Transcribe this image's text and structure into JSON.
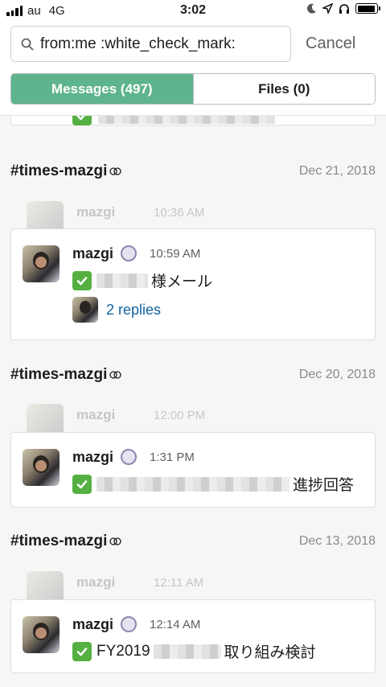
{
  "status_bar": {
    "carrier": "au",
    "network": "4G",
    "time": "3:02"
  },
  "search": {
    "query": "from:me :white_check_mark:",
    "cancel_label": "Cancel"
  },
  "tabs": [
    {
      "label": "Messages (497)",
      "active": true
    },
    {
      "label": "Files (0)",
      "active": false
    }
  ],
  "groups": [
    {
      "channel": "#times-mazgi",
      "date": "Dec 21, 2018",
      "ghost": {
        "name": "mazgi",
        "time": "10:36 AM"
      },
      "message": {
        "author": "mazgi",
        "time": "10:59 AM",
        "text": "様メール",
        "replies": "2 replies"
      }
    },
    {
      "channel": "#times-mazgi",
      "date": "Dec 20, 2018",
      "ghost": {
        "name": "mazgi",
        "time": "12:00 PM"
      },
      "message": {
        "author": "mazgi",
        "time": "1:31 PM",
        "text": "進捗回答"
      }
    },
    {
      "channel": "#times-mazgi",
      "date": "Dec 13, 2018",
      "ghost": {
        "name": "mazgi",
        "time": "12:11 AM"
      },
      "message": {
        "author": "mazgi",
        "time": "12:14 AM",
        "text_prefix": "FY2019",
        "text": "取り組み検討"
      }
    }
  ],
  "icons": {
    "search": "search-icon",
    "check": "white-check-mark-icon",
    "channel_shared": "shared-channel-icon",
    "bot": "bot-badge-icon"
  },
  "colors": {
    "tab_active": "#5eb48c",
    "link": "#1264a3",
    "check": "#56b041"
  }
}
